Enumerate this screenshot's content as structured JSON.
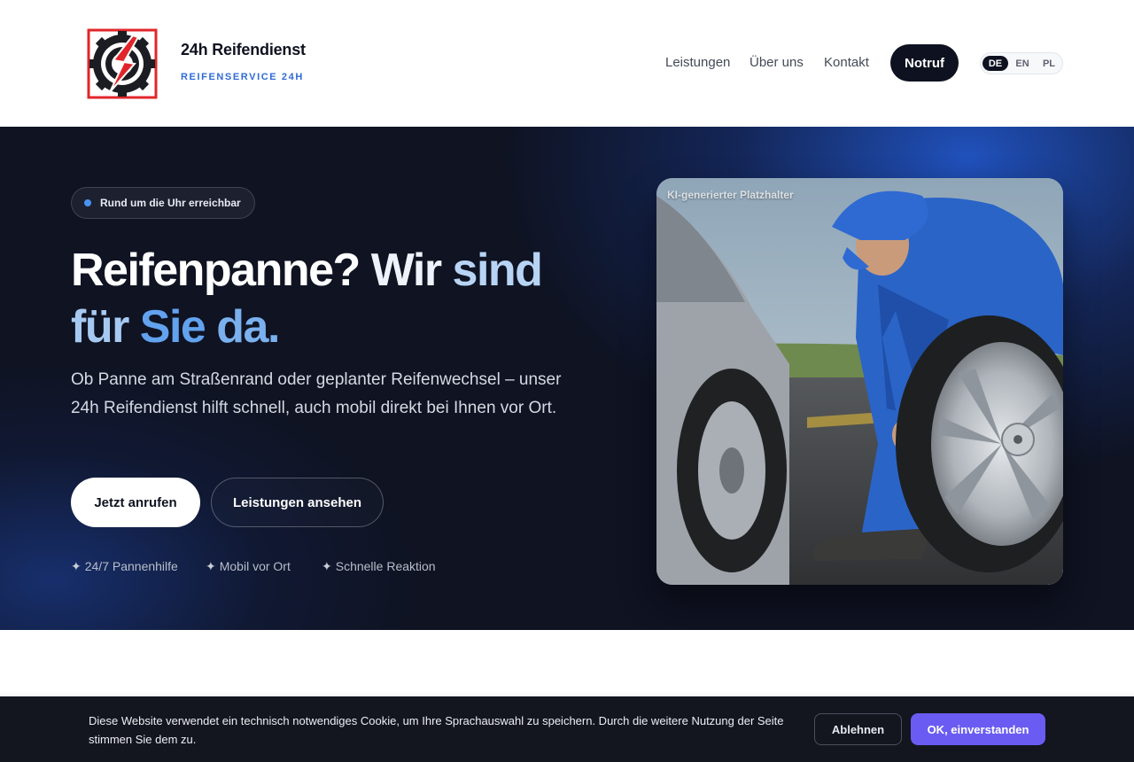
{
  "header": {
    "brand_name": "24h Reifendienst",
    "brand_tagline": "REIFENSERVICE 24H",
    "logo_icon": "tire-gear-bolt-logo",
    "nav": [
      {
        "label": "Leistungen"
      },
      {
        "label": "Über uns"
      },
      {
        "label": "Kontakt"
      }
    ],
    "emergency_button": "Notruf",
    "languages": [
      {
        "code": "DE",
        "active": true
      },
      {
        "code": "EN",
        "active": false
      },
      {
        "code": "PL",
        "active": false
      }
    ]
  },
  "hero": {
    "badge": "Rund um die Uhr erreichbar",
    "headline_words": [
      "Reifenpanne?",
      "Wir",
      "sind",
      "für",
      "Sie",
      "da."
    ],
    "lead": "Ob Panne am Straßenrand oder geplanter Reifenwechsel – unser 24h Reifendienst hilft schnell, auch mobil direkt bei Ihnen vor Ort.",
    "primary_button": "Jetzt anrufen",
    "secondary_button": "Leistungen ansehen",
    "features": [
      {
        "icon": "sparkle-icon",
        "label": "24/7 Pannenhilfe"
      },
      {
        "icon": "sparkle-icon",
        "label": "Mobil vor Ort"
      },
      {
        "icon": "sparkle-icon",
        "label": "Schnelle Reaktion"
      }
    ],
    "image_label": "KI-generierter Platzhalter"
  },
  "cookie": {
    "text": "Diese Website verwendet ein technisch notwendiges Cookie, um Ihre Sprachauswahl zu speichern. Durch die weitere Nutzung der Seite stimmen Sie dem zu.",
    "decline": "Ablehnen",
    "accept": "OK, einverstanden"
  },
  "colors": {
    "hero_bg": "#0f1322",
    "accent_blue": "#2f6bd8",
    "accept_purple": "#6a5cf2",
    "logo_red": "#e0262b"
  }
}
